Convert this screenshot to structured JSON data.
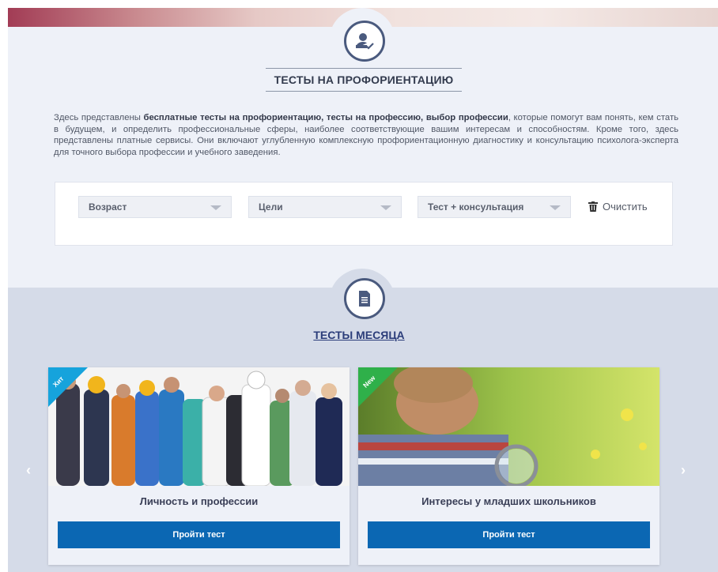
{
  "header": {
    "title": "ТЕСТЫ НА ПРОФОРИЕНТАЦИЮ"
  },
  "intro": {
    "p1": "Здесь представлены ",
    "bold": "бесплатные тесты на профориентацию, тесты на профессию, выбор профессии",
    "p2": ", которые помогут вам понять, кем стать в будущем, и определить профессиональные сферы, наиболее соответствующие вашим интересам и способностям. Кроме того, здесь представлены платные сервисы. Они включают углубленную комплексную профориентационную диагностику и консультацию психолога-эксперта для точного выбора профессии и учебного заведения."
  },
  "filters": {
    "age": "Возраст",
    "goals": "Цели",
    "type": "Тест + консультация",
    "clear_label": "Очистить"
  },
  "month_tests": {
    "title": "ТЕСТЫ МЕСЯЦА",
    "cards": [
      {
        "badge": "Хит",
        "badge_color": "#16a3dc",
        "title": "Личность и профессии",
        "button": "Пройти тест"
      },
      {
        "badge": "New",
        "badge_color": "#2fb04a",
        "title": "Интересы у младших школьников",
        "button": "Пройти тест"
      }
    ]
  },
  "colors": {
    "accent": "#0b67b3",
    "title_link": "#2b3d7a"
  }
}
